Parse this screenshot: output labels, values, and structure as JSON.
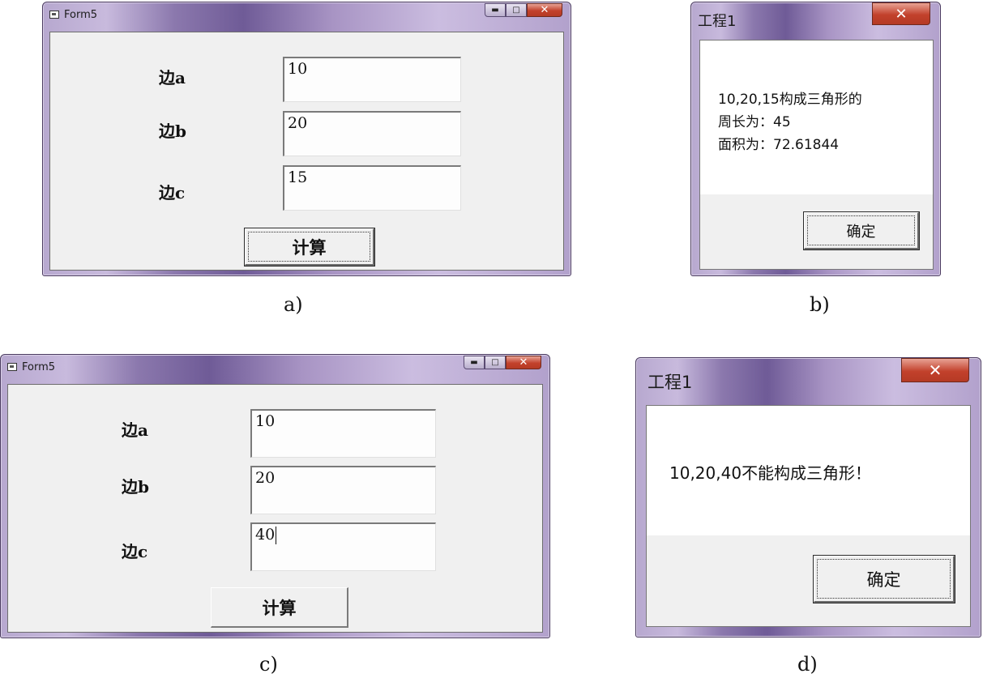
{
  "panel_a": {
    "window_title": "Form5",
    "label_a": "边a",
    "label_b": "边b",
    "label_c": "边c",
    "value_a": "10",
    "value_b": "20",
    "value_c": "15",
    "compute_label": "计算",
    "caption": "a)"
  },
  "panel_b": {
    "window_title": "工程1",
    "line1": "10,20,15构成三角形的",
    "line2": "周长为：45",
    "line3": "面积为：72.61844",
    "ok_label": "确定",
    "caption": "b)"
  },
  "panel_c": {
    "window_title": "Form5",
    "label_a": "边a",
    "label_b": "边b",
    "label_c": "边c",
    "value_a": "10",
    "value_b": "20",
    "value_c": "40",
    "compute_label": "计算",
    "caption": "c)"
  },
  "panel_d": {
    "window_title": "工程1",
    "message": "10,20,40不能构成三角形！",
    "ok_label": "确定",
    "caption": "d)"
  },
  "icons": {
    "minimize": "minimize-icon",
    "maximize": "maximize-icon",
    "close": "close-icon",
    "app": "form-app-icon"
  },
  "colors": {
    "frame": "#8b78ad",
    "client": "#f0f0f0",
    "close_button": "#c2412c"
  }
}
